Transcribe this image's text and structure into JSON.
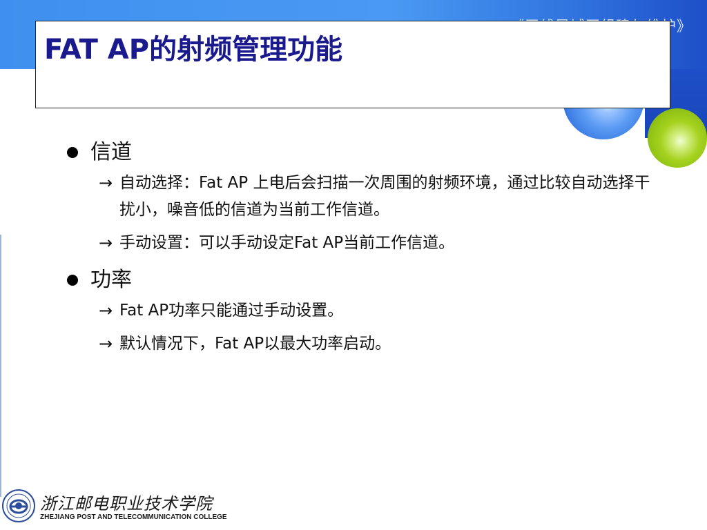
{
  "header": {
    "course_title": "《无线局域网组建与维护》"
  },
  "slide": {
    "title": "FAT AP的射频管理功能"
  },
  "sections": [
    {
      "label": "信道",
      "items": [
        "自动选择：Fat AP 上电后会扫描一次周围的射频环境，通过比较自动选择干扰小，噪音低的信道为当前工作信道。",
        "手动设置：可以手动设定Fat AP当前工作信道。"
      ]
    },
    {
      "label": "功率",
      "items": [
        "Fat AP功率只能通过手动设置。",
        "默认情况下，Fat AP以最大功率启动。"
      ]
    }
  ],
  "footer": {
    "college_name_cn": "浙江邮电职业技术学院",
    "college_name_en": "ZHEJIANG POST AND TELECOMMUNICATION COLLEGE"
  },
  "icons": {
    "bullet": "filled-circle",
    "sub_bullet": "right-arrow",
    "logo": "college-seal-logo"
  },
  "colors": {
    "title": "#1a1a8e",
    "header_band": "#3f8ff0",
    "header_band_dark": "#1e4fc8",
    "accent_ball_blue": "#5c9cf4",
    "accent_ball_green": "#a6d21f"
  }
}
